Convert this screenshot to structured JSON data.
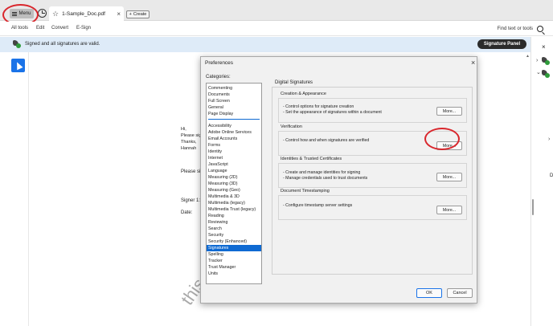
{
  "app": {
    "menu_label": "Menu",
    "tab_title": "1-Sample_Doc.pdf",
    "tab_close": "×",
    "create_label": "Create",
    "create_plus": "+"
  },
  "toolbar": {
    "items": [
      "All tools",
      "Edit",
      "Convert",
      "E-Sign"
    ],
    "find_text": "Find text or tools"
  },
  "banner": {
    "message": "Signed and all signatures are valid.",
    "signature_panel_label": "Signature Panel"
  },
  "document": {
    "lines": [
      "Hi,",
      "Please sign",
      "Thanks,",
      "Hannah",
      "Please sig",
      "Signer 1:",
      "Date:"
    ],
    "watermark": "this do        not doe"
  },
  "right_panel": {
    "close": "×",
    "chev_right": "›",
    "chev_down": "⌄",
    "letter": "D"
  },
  "dialog": {
    "title": "Preferences",
    "close": "×",
    "categories_label": "Categories:",
    "categories_top": [
      "Commenting",
      "Documents",
      "Full Screen",
      "General",
      "Page Display"
    ],
    "categories": [
      "Accessibility",
      "Adobe Online Services",
      "Email Accounts",
      "Forms",
      "Identity",
      "Internet",
      "JavaScript",
      "Language",
      "Measuring (2D)",
      "Measuring (3D)",
      "Measuring (Geo)",
      "Multimedia & 3D",
      "Multimedia (legacy)",
      "Multimedia Trust (legacy)",
      "Reading",
      "Reviewing",
      "Search",
      "Security",
      "Security (Enhanced)",
      "Signatures",
      "Spelling",
      "Tracker",
      "Trust Manager",
      "Units"
    ],
    "selected_category": "Signatures",
    "section_title": "Digital Signatures",
    "groups": [
      {
        "title": "Creation & Appearance",
        "lines": [
          "- Control options for signature creation",
          "- Set the appearance of signatures within a document"
        ],
        "button": "More..."
      },
      {
        "title": "Verification",
        "lines": [
          "- Control how and when signatures are verified"
        ],
        "button": "More..."
      },
      {
        "title": "Identities & Trusted Certificates",
        "lines": [
          "- Create and manage identities for signing",
          "- Manage credentials used to trust documents"
        ],
        "button": "More..."
      },
      {
        "title": "Document Timestamping",
        "lines": [
          "- Configure timestamp server settings"
        ],
        "button": "More..."
      }
    ],
    "ok_label": "OK",
    "cancel_label": "Cancel"
  },
  "colors": {
    "accent": "#1a73e8",
    "selection": "#0f6ad2",
    "banner_bg": "#deebf8",
    "annotation_red": "#d9262c",
    "valid_green": "#2e9b3a"
  }
}
